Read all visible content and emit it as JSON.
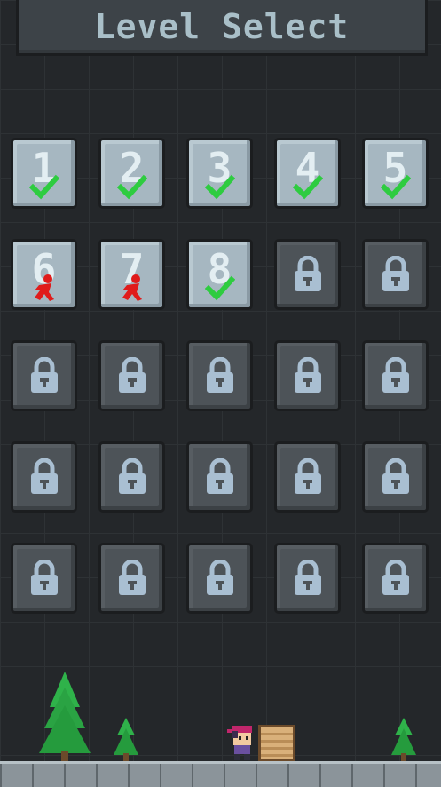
{
  "header": {
    "title": "Level Select"
  },
  "levels": [
    {
      "number": "1",
      "status": "completed"
    },
    {
      "number": "2",
      "status": "completed"
    },
    {
      "number": "3",
      "status": "completed"
    },
    {
      "number": "4",
      "status": "completed"
    },
    {
      "number": "5",
      "status": "completed"
    },
    {
      "number": "6",
      "status": "died"
    },
    {
      "number": "7",
      "status": "died"
    },
    {
      "number": "8",
      "status": "completed"
    },
    {
      "number": "",
      "status": "locked"
    },
    {
      "number": "",
      "status": "locked"
    },
    {
      "number": "",
      "status": "locked"
    },
    {
      "number": "",
      "status": "locked"
    },
    {
      "number": "",
      "status": "locked"
    },
    {
      "number": "",
      "status": "locked"
    },
    {
      "number": "",
      "status": "locked"
    },
    {
      "number": "",
      "status": "locked"
    },
    {
      "number": "",
      "status": "locked"
    },
    {
      "number": "",
      "status": "locked"
    },
    {
      "number": "",
      "status": "locked"
    },
    {
      "number": "",
      "status": "locked"
    },
    {
      "number": "",
      "status": "locked"
    },
    {
      "number": "",
      "status": "locked"
    },
    {
      "number": "",
      "status": "locked"
    },
    {
      "number": "",
      "status": "locked"
    },
    {
      "number": "",
      "status": "locked"
    }
  ],
  "icons": {
    "completed": "check-icon",
    "died": "red-runner-icon",
    "locked": "padlock-icon"
  },
  "colors": {
    "check": "#2ecc40",
    "died": "#e01b1b",
    "tree": "#2fb24a",
    "lock": "#a9bfd2"
  }
}
